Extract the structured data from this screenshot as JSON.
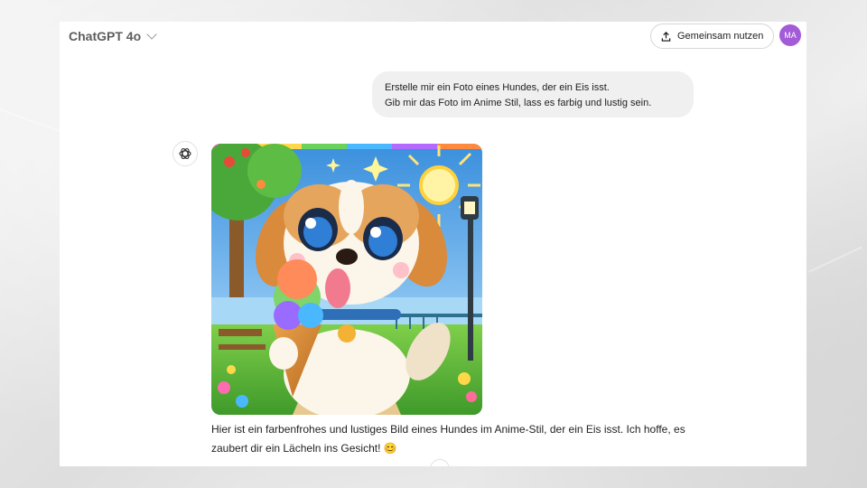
{
  "header": {
    "model_label": "ChatGPT 4o",
    "share_label": "Gemeinsam nutzen",
    "avatar_initials": "MA"
  },
  "conversation": {
    "user_message_line1": "Erstelle mir ein Foto eines Hundes, der ein Eis isst.",
    "user_message_line2": "Gib mir das Foto im Anime Stil, lass es farbig und lustig sein.",
    "assistant_reply": "Hier ist ein farbenfrohes und lustiges Bild eines Hundes im Anime-Stil, der ein Eis isst. Ich hoffe, es zaubert dir ein Lächeln ins Gesicht! 😊"
  },
  "annotations": {
    "arrow_color": "#e8782e"
  },
  "colors": {
    "avatar_bg": "#a35bd8",
    "bubble_bg": "#f0f0f0"
  },
  "icons": [
    "chevron-down-icon",
    "upload-icon",
    "openai-logo-icon",
    "arrow-up-icon",
    "arrow-left-icon"
  ]
}
